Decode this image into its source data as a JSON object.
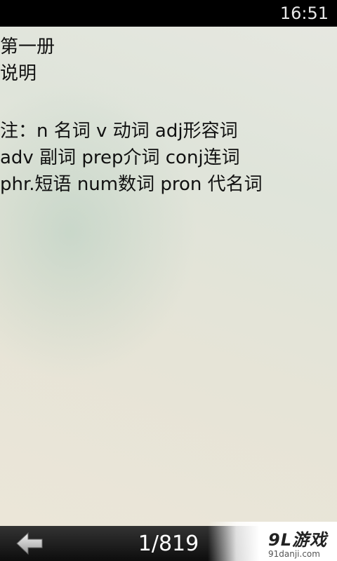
{
  "status_bar": {
    "time": "16:51"
  },
  "content": {
    "lines": [
      "第一册",
      "说明",
      "",
      "注：n 名词 v 动词 adj形容词",
      "adv 副词 prep介词 conj连词",
      "phr.短语 num数词 pron 代名词"
    ]
  },
  "bottom_bar": {
    "back_icon": "arrow-left-icon",
    "page_indicator": "1/819"
  },
  "watermark": {
    "logo_text": "9L游戏",
    "url_text": "91danji.com"
  }
}
